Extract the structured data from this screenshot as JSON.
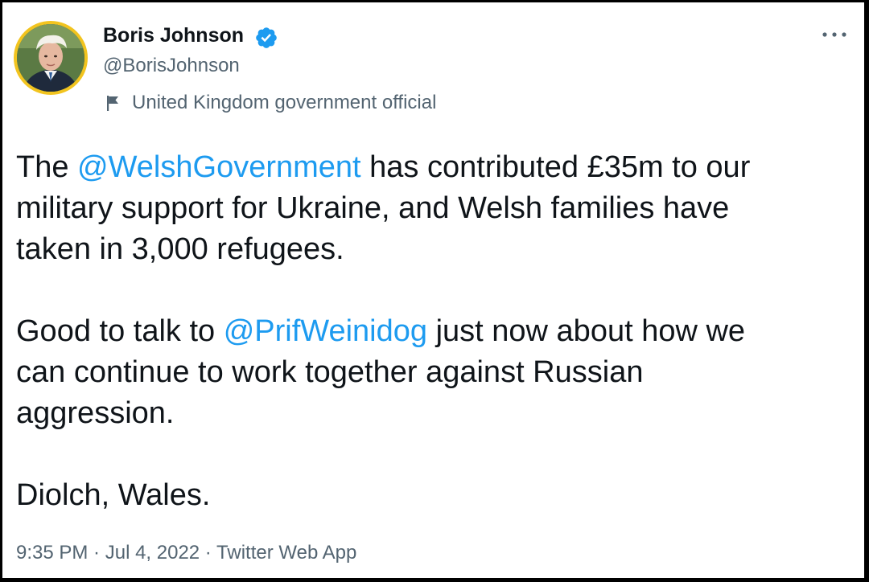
{
  "author": {
    "display_name": "Boris Johnson",
    "handle": "@BorisJohnson",
    "label": "United Kingdom government official",
    "verified_icon": "verified-badge-icon",
    "avatar_ring_color": "#f2c41f"
  },
  "tweet": {
    "p1_before": "The ",
    "p1_mention": "@WelshGovernment",
    "p1_line1_rest": " has contributed £35m to our",
    "p1_line2": "military support for Ukraine, and Welsh families have",
    "p1_line3": "taken in 3,000 refugees.",
    "p2_before": "Good to talk to ",
    "p2_mention": "@PrifWeinidog",
    "p2_line1_rest": " just now about how we",
    "p2_line2": "can continue to work together against Russian",
    "p2_line3": "aggression.",
    "p3": "Diolch, Wales."
  },
  "meta": {
    "time": "9:35 PM",
    "date": "Jul 4, 2022",
    "source": "Twitter Web App",
    "separator": " · "
  },
  "colors": {
    "mention": "#1d9bf0",
    "text": "#0f1419",
    "secondary": "#536471"
  }
}
